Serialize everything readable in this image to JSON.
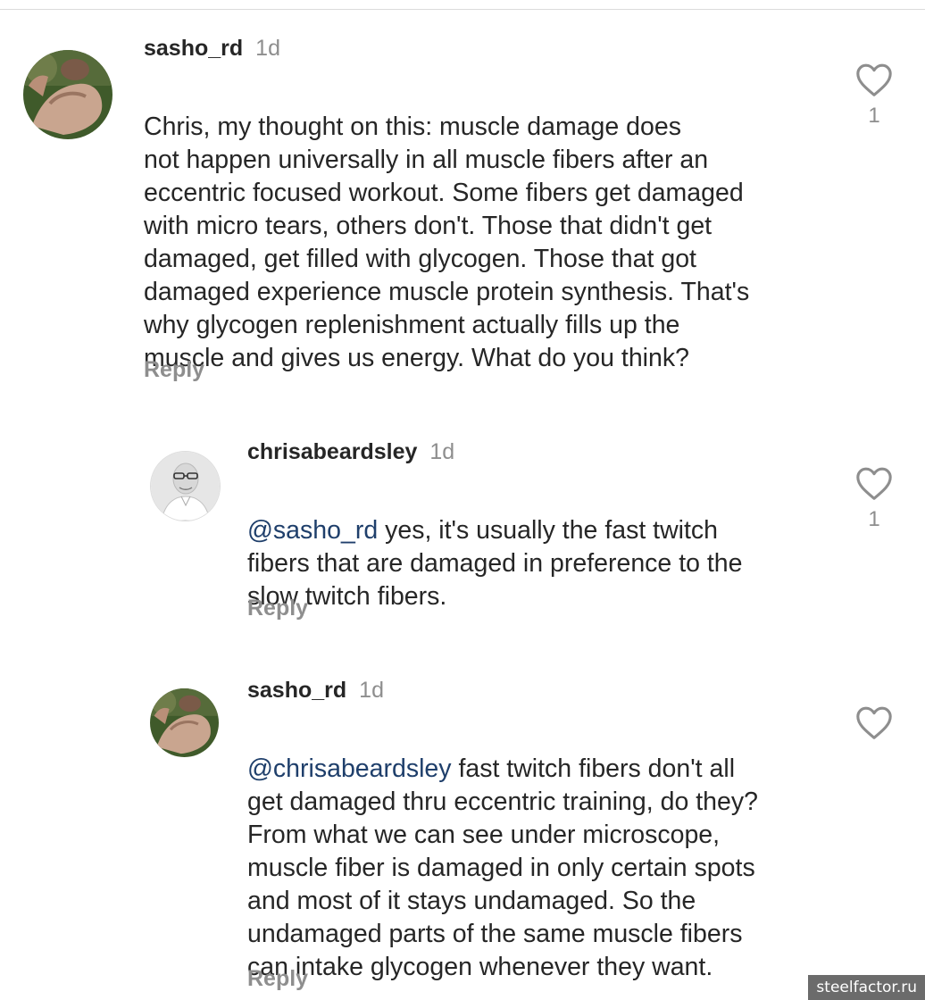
{
  "comments": [
    {
      "username": "sasho_rd",
      "time": "1d",
      "mention": "",
      "text": "Chris, my thought on this: muscle damage does\nnot happen universally in all muscle fibers after an\neccentric focused workout.  Some fibers get damaged\nwith micro tears, others don't.  Those that didn't get\ndamaged, get filled with glycogen.  Those that got\ndamaged experience muscle protein synthesis.  That's\nwhy glycogen replenishment actually fills up the\nmuscle and gives us energy.  What do you think?",
      "reply_label": "Reply",
      "like_count": "1",
      "avatar_icon": "flexing-arm-photo"
    },
    {
      "username": "chrisabeardsley",
      "time": "1d",
      "mention": "@sasho_rd",
      "text": " yes, it's usually the fast twitch\nfibers that are damaged in preference to the\nslow twitch fibers.",
      "reply_label": "Reply",
      "like_count": "1",
      "avatar_icon": "bald-man-portrait-photo"
    },
    {
      "username": "sasho_rd",
      "time": "1d",
      "mention": "@chrisabeardsley",
      "text": " fast twitch fibers don't all\nget damaged thru eccentric training, do they?\nFrom what we can see under microscope,\nmuscle fiber is damaged in only certain spots\nand most of it stays undamaged.  So the\nundamaged parts of the same muscle fibers\ncan intake glycogen whenever they want.",
      "reply_label": "Reply",
      "like_count": "",
      "avatar_icon": "flexing-arm-photo"
    }
  ],
  "watermark": "steelfactor.ru",
  "colors": {
    "text": "#262626",
    "secondary": "#8e8e8e",
    "mention": "#1f3f6b",
    "divider": "#dbdbdb"
  },
  "icons": {
    "like": "heart-outline-icon"
  }
}
